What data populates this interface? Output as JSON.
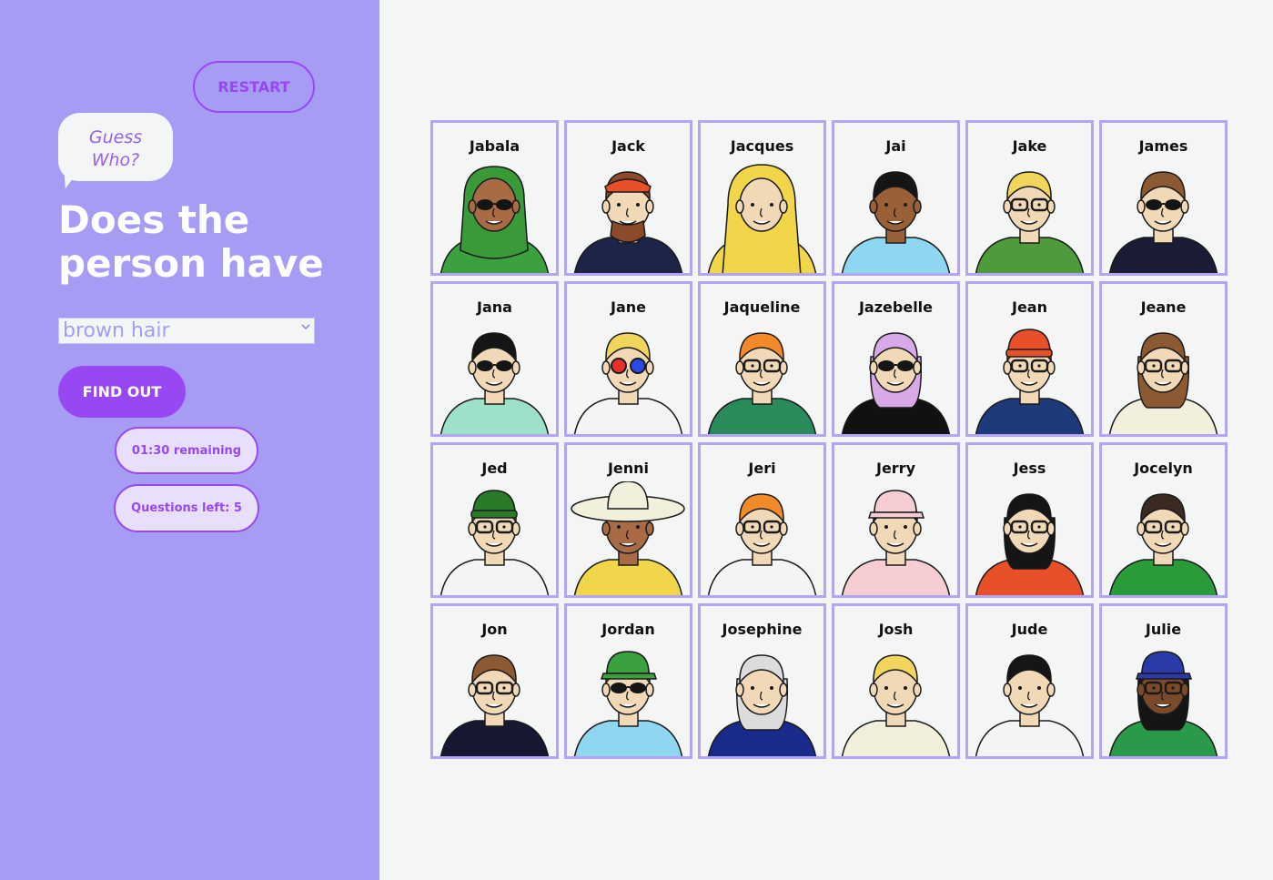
{
  "sidebar": {
    "restart_label": "RESTART",
    "logo_line1": "Guess",
    "logo_line2": "Who?",
    "question_line1": "Does the",
    "question_line2": "person have",
    "select_value": "brown hair",
    "find_out_label": "FIND OUT",
    "timer_text": "01:30 remaining",
    "questions_left_text": "Questions left: 5"
  },
  "colors": {
    "sidebar_bg": "#a69cf4",
    "accent": "#9848f2",
    "card_border": "#b3a5f3",
    "board_bg": "#f4f5f5"
  },
  "characters": [
    {
      "name": "Jabala",
      "hair": "#3a9a3a",
      "shirt": "#3aa040",
      "skin": "#a86b45",
      "glasses": "sun",
      "hat": "hijab"
    },
    {
      "name": "Jack",
      "hair": "#8b4a2a",
      "shirt": "#1e2448",
      "skin": "#f1d9b8",
      "glasses": "none",
      "hat": "bandana"
    },
    {
      "name": "Jacques",
      "hair": "#dddddd",
      "shirt": "#f2d64a",
      "skin": "#f1d9b8",
      "glasses": "none",
      "hat": "raincoat"
    },
    {
      "name": "Jai",
      "hair": "#151515",
      "shirt": "#8fd6f0",
      "skin": "#9a6038",
      "glasses": "none",
      "hat": "none"
    },
    {
      "name": "Jake",
      "hair": "#f2d55c",
      "shirt": "#4f9a3a",
      "skin": "#f1d9b8",
      "glasses": "black",
      "hat": "none"
    },
    {
      "name": "James",
      "hair": "#8b5a32",
      "shirt": "#1a1c36",
      "skin": "#f1d9b8",
      "glasses": "sun",
      "hat": "none"
    },
    {
      "name": "Jana",
      "hair": "#151515",
      "shirt": "#9fe0c8",
      "skin": "#f1d9b8",
      "glasses": "sun",
      "hat": "none"
    },
    {
      "name": "Jane",
      "hair": "#f2d55c",
      "shirt": "#f4f4f4",
      "skin": "#f1d9b8",
      "glasses": "color",
      "hat": "none"
    },
    {
      "name": "Jaqueline",
      "hair": "#f28a2a",
      "shirt": "#2a8a5a",
      "skin": "#f1d9b8",
      "glasses": "black",
      "hat": "none"
    },
    {
      "name": "Jazebelle",
      "hair": "#d9a8e6",
      "shirt": "#111111",
      "skin": "#f1d9b8",
      "glasses": "sun",
      "hat": "none"
    },
    {
      "name": "Jean",
      "hair": "#f28a2a",
      "shirt": "#1e3a7a",
      "skin": "#f1d9b8",
      "glasses": "black",
      "hat": "beanie-red"
    },
    {
      "name": "Jeane",
      "hair": "#8b5a32",
      "shirt": "#f2f0dc",
      "skin": "#f1d9b8",
      "glasses": "black",
      "hat": "none"
    },
    {
      "name": "Jed",
      "hair": "#f28a2a",
      "shirt": "#f4f4f4",
      "skin": "#f1d9b8",
      "glasses": "black",
      "hat": "beanie-green"
    },
    {
      "name": "Jenni",
      "hair": "#222222",
      "shirt": "#f2d64a",
      "skin": "#a86b45",
      "glasses": "none",
      "hat": "sunhat"
    },
    {
      "name": "Jeri",
      "hair": "#f28a2a",
      "shirt": "#f4f4f4",
      "skin": "#f1d9b8",
      "glasses": "black",
      "hat": "none"
    },
    {
      "name": "Jerry",
      "hair": "#222222",
      "shirt": "#f6cdd2",
      "skin": "#f1d9b8",
      "glasses": "none",
      "hat": "cap-pink"
    },
    {
      "name": "Jess",
      "hair": "#151515",
      "shirt": "#e8502a",
      "skin": "#f1d9b8",
      "glasses": "black",
      "hat": "none"
    },
    {
      "name": "Jocelyn",
      "hair": "#3a2a22",
      "shirt": "#2a9a3a",
      "skin": "#f1d9b8",
      "glasses": "black",
      "hat": "none"
    },
    {
      "name": "Jon",
      "hair": "#8b5a32",
      "shirt": "#151830",
      "skin": "#f1d9b8",
      "glasses": "black",
      "hat": "none"
    },
    {
      "name": "Jordan",
      "hair": "#f2d55c",
      "shirt": "#8fd6f0",
      "skin": "#f1d9b8",
      "glasses": "sun",
      "hat": "cap-green"
    },
    {
      "name": "Josephine",
      "hair": "#dcdcdc",
      "shirt": "#1a2a8a",
      "skin": "#f1d9b8",
      "glasses": "none",
      "hat": "none"
    },
    {
      "name": "Josh",
      "hair": "#f2d55c",
      "shirt": "#f2f0dc",
      "skin": "#f1d9b8",
      "glasses": "none",
      "hat": "none"
    },
    {
      "name": "Jude",
      "hair": "#151515",
      "shirt": "#f4f4f4",
      "skin": "#f1d9b8",
      "glasses": "none",
      "hat": "none"
    },
    {
      "name": "Julie",
      "hair": "#151515",
      "shirt": "#2a9a4a",
      "skin": "#7a4a2a",
      "glasses": "black",
      "hat": "cap-blue"
    }
  ]
}
